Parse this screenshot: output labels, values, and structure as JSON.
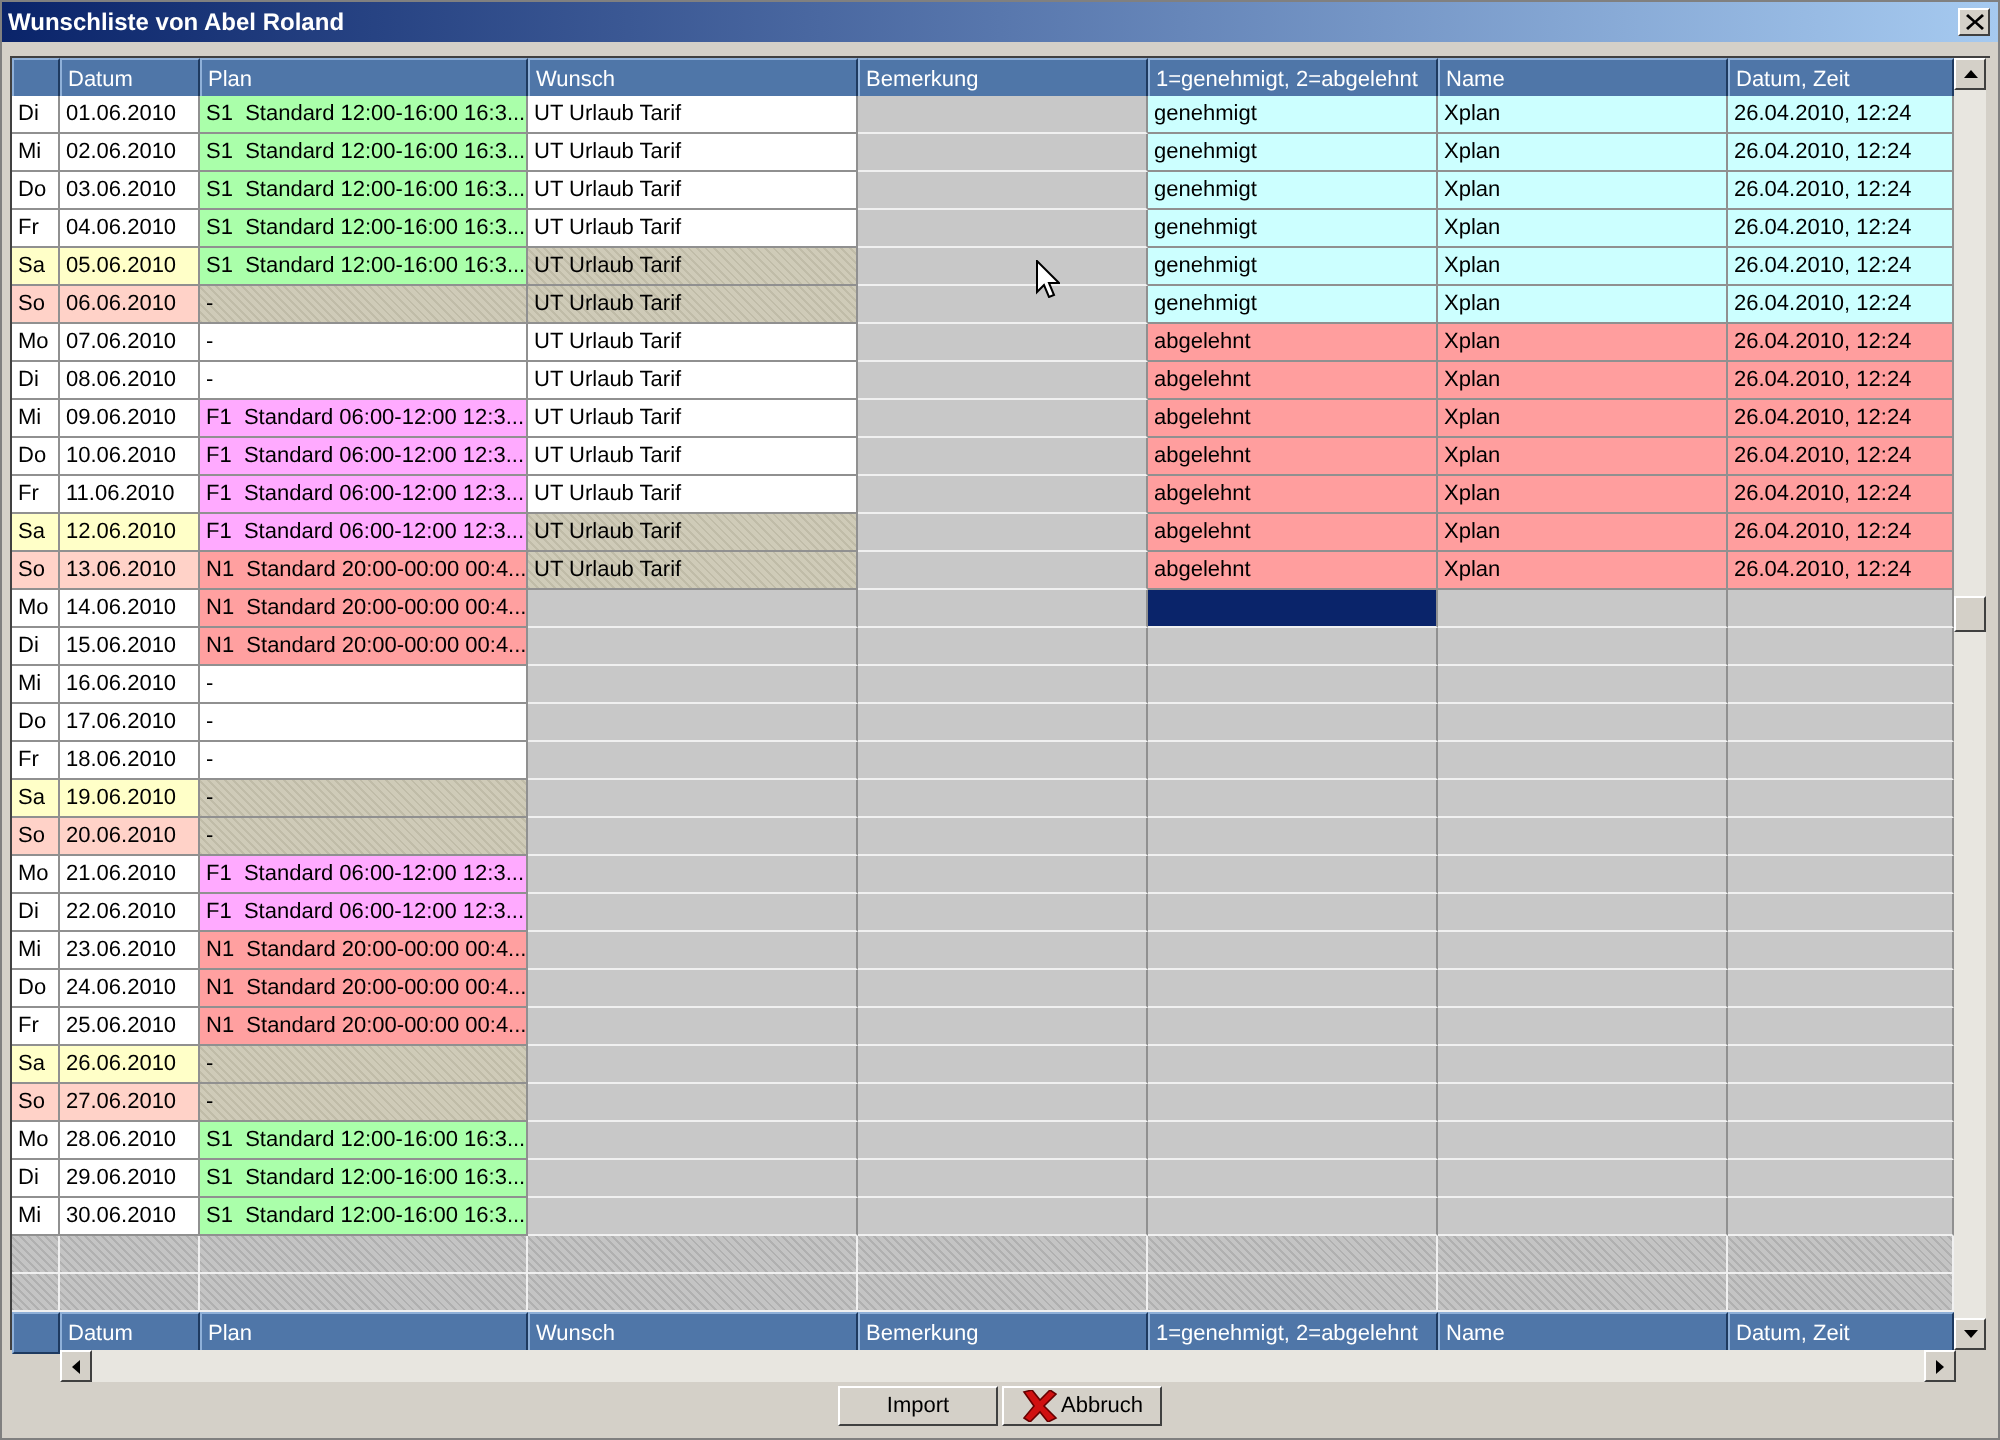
{
  "window": {
    "title": "Wunschliste von Abel Roland"
  },
  "columns": [
    "",
    "Datum",
    "Plan",
    "Wunsch",
    "Bemerkung",
    "1=genehmigt, 2=abgelehnt",
    "Name",
    "Datum, Zeit"
  ],
  "rows": [
    {
      "day": {
        "text": "Di",
        "kind": "weekday"
      },
      "date": "01.06.2010",
      "plan": {
        "text": "S1  Standard 12:00-16:00 16:3...",
        "color": "#aaffaa"
      },
      "wish": "UT Urlaub Tarif",
      "status": {
        "text": "genehmigt",
        "kind": "approved"
      },
      "name": "Xplan",
      "timestamp": "26.04.2010, 12:24",
      "selected": false
    },
    {
      "day": {
        "text": "Mi",
        "kind": "weekday"
      },
      "date": "02.06.2010",
      "plan": {
        "text": "S1  Standard 12:00-16:00 16:3...",
        "color": "#aaffaa"
      },
      "wish": "UT Urlaub Tarif",
      "status": {
        "text": "genehmigt",
        "kind": "approved"
      },
      "name": "Xplan",
      "timestamp": "26.04.2010, 12:24",
      "selected": false
    },
    {
      "day": {
        "text": "Do",
        "kind": "weekday"
      },
      "date": "03.06.2010",
      "plan": {
        "text": "S1  Standard 12:00-16:00 16:3...",
        "color": "#aaffaa"
      },
      "wish": "UT Urlaub Tarif",
      "status": {
        "text": "genehmigt",
        "kind": "approved"
      },
      "name": "Xplan",
      "timestamp": "26.04.2010, 12:24",
      "selected": false
    },
    {
      "day": {
        "text": "Fr",
        "kind": "weekday"
      },
      "date": "04.06.2010",
      "plan": {
        "text": "S1  Standard 12:00-16:00 16:3...",
        "color": "#aaffaa"
      },
      "wish": "UT Urlaub Tarif",
      "status": {
        "text": "genehmigt",
        "kind": "approved"
      },
      "name": "Xplan",
      "timestamp": "26.04.2010, 12:24",
      "selected": false
    },
    {
      "day": {
        "text": "Sa",
        "kind": "saturday"
      },
      "date": "05.06.2010",
      "plan": {
        "text": "S1  Standard 12:00-16:00 16:3...",
        "color": "#aaffaa"
      },
      "wish": "UT Urlaub Tarif",
      "status": {
        "text": "genehmigt",
        "kind": "approved"
      },
      "name": "Xplan",
      "timestamp": "26.04.2010, 12:24",
      "selected": false
    },
    {
      "day": {
        "text": "So",
        "kind": "sunday"
      },
      "date": "06.06.2010",
      "plan": {
        "text": "-"
      },
      "wish": "UT Urlaub Tarif",
      "status": {
        "text": "genehmigt",
        "kind": "approved"
      },
      "name": "Xplan",
      "timestamp": "26.04.2010, 12:24",
      "selected": false
    },
    {
      "day": {
        "text": "Mo",
        "kind": "weekday"
      },
      "date": "07.06.2010",
      "plan": {
        "text": "-"
      },
      "wish": "UT Urlaub Tarif",
      "status": {
        "text": "abgelehnt",
        "kind": "rejected"
      },
      "name": "Xplan",
      "timestamp": "26.04.2010, 12:24",
      "selected": false
    },
    {
      "day": {
        "text": "Di",
        "kind": "weekday"
      },
      "date": "08.06.2010",
      "plan": {
        "text": "-"
      },
      "wish": "UT Urlaub Tarif",
      "status": {
        "text": "abgelehnt",
        "kind": "rejected"
      },
      "name": "Xplan",
      "timestamp": "26.04.2010, 12:24",
      "selected": false
    },
    {
      "day": {
        "text": "Mi",
        "kind": "weekday"
      },
      "date": "09.06.2010",
      "plan": {
        "text": "F1  Standard 06:00-12:00 12:3...",
        "color": "#ffaaff"
      },
      "wish": "UT Urlaub Tarif",
      "status": {
        "text": "abgelehnt",
        "kind": "rejected"
      },
      "name": "Xplan",
      "timestamp": "26.04.2010, 12:24",
      "selected": false
    },
    {
      "day": {
        "text": "Do",
        "kind": "weekday"
      },
      "date": "10.06.2010",
      "plan": {
        "text": "F1  Standard 06:00-12:00 12:3...",
        "color": "#ffaaff"
      },
      "wish": "UT Urlaub Tarif",
      "status": {
        "text": "abgelehnt",
        "kind": "rejected"
      },
      "name": "Xplan",
      "timestamp": "26.04.2010, 12:24",
      "selected": false
    },
    {
      "day": {
        "text": "Fr",
        "kind": "weekday"
      },
      "date": "11.06.2010",
      "plan": {
        "text": "F1  Standard 06:00-12:00 12:3...",
        "color": "#ffaaff"
      },
      "wish": "UT Urlaub Tarif",
      "status": {
        "text": "abgelehnt",
        "kind": "rejected"
      },
      "name": "Xplan",
      "timestamp": "26.04.2010, 12:24",
      "selected": false
    },
    {
      "day": {
        "text": "Sa",
        "kind": "saturday"
      },
      "date": "12.06.2010",
      "plan": {
        "text": "F1  Standard 06:00-12:00 12:3...",
        "color": "#ffaaff"
      },
      "wish": "UT Urlaub Tarif",
      "status": {
        "text": "abgelehnt",
        "kind": "rejected"
      },
      "name": "Xplan",
      "timestamp": "26.04.2010, 12:24",
      "selected": false
    },
    {
      "day": {
        "text": "So",
        "kind": "sunday"
      },
      "date": "13.06.2010",
      "plan": {
        "text": "N1  Standard 20:00-00:00 00:4...",
        "color": "#ffa0a0"
      },
      "wish": "UT Urlaub Tarif",
      "status": {
        "text": "abgelehnt",
        "kind": "rejected"
      },
      "name": "Xplan",
      "timestamp": "26.04.2010, 12:24",
      "selected": false
    },
    {
      "day": {
        "text": "Mo",
        "kind": "weekday"
      },
      "date": "14.06.2010",
      "plan": {
        "text": "N1  Standard 20:00-00:00 00:4...",
        "color": "#ffa0a0"
      },
      "selected": true
    },
    {
      "day": {
        "text": "Di",
        "kind": "weekday"
      },
      "date": "15.06.2010",
      "plan": {
        "text": "N1  Standard 20:00-00:00 00:4...",
        "color": "#ffa0a0"
      },
      "selected": false
    },
    {
      "day": {
        "text": "Mi",
        "kind": "weekday"
      },
      "date": "16.06.2010",
      "plan": {
        "text": "-"
      },
      "selected": false
    },
    {
      "day": {
        "text": "Do",
        "kind": "weekday"
      },
      "date": "17.06.2010",
      "plan": {
        "text": "-"
      },
      "selected": false
    },
    {
      "day": {
        "text": "Fr",
        "kind": "weekday"
      },
      "date": "18.06.2010",
      "plan": {
        "text": "-"
      },
      "selected": false
    },
    {
      "day": {
        "text": "Sa",
        "kind": "saturday"
      },
      "date": "19.06.2010",
      "plan": {
        "text": "-"
      },
      "selected": false
    },
    {
      "day": {
        "text": "So",
        "kind": "sunday"
      },
      "date": "20.06.2010",
      "plan": {
        "text": "-"
      },
      "selected": false
    },
    {
      "day": {
        "text": "Mo",
        "kind": "weekday"
      },
      "date": "21.06.2010",
      "plan": {
        "text": "F1  Standard 06:00-12:00 12:3...",
        "color": "#ffaaff"
      },
      "selected": false
    },
    {
      "day": {
        "text": "Di",
        "kind": "weekday"
      },
      "date": "22.06.2010",
      "plan": {
        "text": "F1  Standard 06:00-12:00 12:3...",
        "color": "#ffaaff"
      },
      "selected": false
    },
    {
      "day": {
        "text": "Mi",
        "kind": "weekday"
      },
      "date": "23.06.2010",
      "plan": {
        "text": "N1  Standard 20:00-00:00 00:4...",
        "color": "#ffa0a0"
      },
      "selected": false
    },
    {
      "day": {
        "text": "Do",
        "kind": "weekday"
      },
      "date": "24.06.2010",
      "plan": {
        "text": "N1  Standard 20:00-00:00 00:4...",
        "color": "#ffa0a0"
      },
      "selected": false
    },
    {
      "day": {
        "text": "Fr",
        "kind": "weekday"
      },
      "date": "25.06.2010",
      "plan": {
        "text": "N1  Standard 20:00-00:00 00:4...",
        "color": "#ffa0a0"
      },
      "selected": false
    },
    {
      "day": {
        "text": "Sa",
        "kind": "saturday"
      },
      "date": "26.06.2010",
      "plan": {
        "text": "-"
      },
      "selected": false
    },
    {
      "day": {
        "text": "So",
        "kind": "sunday"
      },
      "date": "27.06.2010",
      "plan": {
        "text": "-"
      },
      "selected": false
    },
    {
      "day": {
        "text": "Mo",
        "kind": "weekday"
      },
      "date": "28.06.2010",
      "plan": {
        "text": "S1  Standard 12:00-16:00 16:3...",
        "color": "#aaffaa"
      },
      "selected": false
    },
    {
      "day": {
        "text": "Di",
        "kind": "weekday"
      },
      "date": "29.06.2010",
      "plan": {
        "text": "S1  Standard 12:00-16:00 16:3...",
        "color": "#aaffaa"
      },
      "selected": false
    },
    {
      "day": {
        "text": "Mi",
        "kind": "weekday"
      },
      "date": "30.06.2010",
      "plan": {
        "text": "S1  Standard 12:00-16:00 16:3...",
        "color": "#aaffaa"
      },
      "selected": false
    }
  ],
  "footer_columns": [
    "",
    "Datum",
    "Plan",
    "Wunsch",
    "Bemerkung",
    "1=genehmigt, 2=abgelehnt",
    "Name",
    "Datum, Zeit"
  ],
  "buttons": [
    {
      "kind": "plain",
      "label": "Import"
    },
    {
      "kind": "cancel",
      "label": "Abbruch"
    }
  ]
}
